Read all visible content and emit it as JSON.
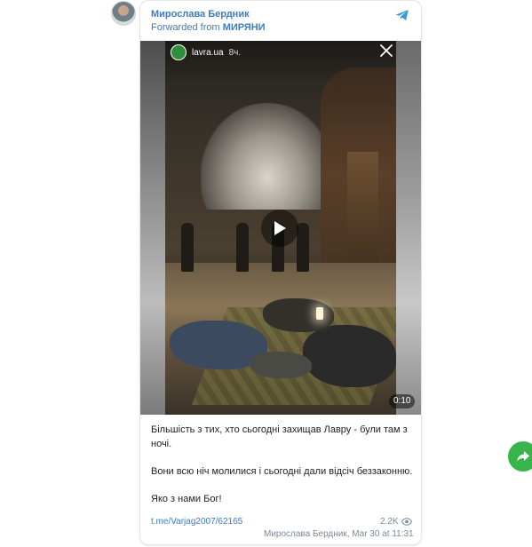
{
  "post": {
    "author": "Мирослава Бердник",
    "forwarded_prefix": "Forwarded from ",
    "forwarded_from": "МИРЯНИ",
    "story": {
      "account": "lavra.ua",
      "time": "8ч.",
      "duration": "0:10"
    },
    "text": {
      "paragraph1": "Більшість з тих, хто сьогодні захищав Лавру - були там з ночі.",
      "paragraph2": "Вони всю ніч молилися і сьогодні дали відсіч беззаконню.",
      "paragraph3": "Яко з нами Бог!"
    },
    "link": "t.me/Varjag2007/62165",
    "views": "2.2K",
    "meta": "Мирослава Бердник, Mar 30 at 11:31"
  },
  "colors": {
    "accent": "#3d7cc1",
    "share_button": "#38b54a"
  },
  "icons": {
    "source": "telegram-icon",
    "close": "close-icon",
    "play": "play-icon",
    "views": "eye-icon",
    "share": "share-icon"
  }
}
